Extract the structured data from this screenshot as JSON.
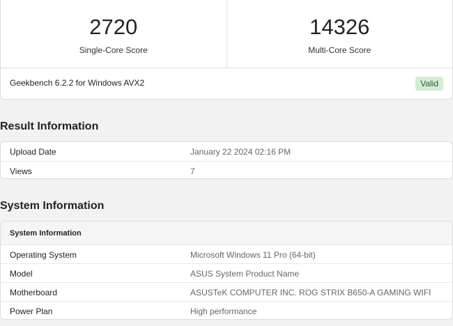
{
  "scores": {
    "single": {
      "value": "2720",
      "label": "Single-Core Score"
    },
    "multi": {
      "value": "14326",
      "label": "Multi-Core Score"
    }
  },
  "version": "Geekbench 6.2.2 for Windows AVX2",
  "validity": "Valid",
  "result_section": {
    "title": "Result Information",
    "rows": [
      {
        "key": "Upload Date",
        "value": "January 22 2024 02:16 PM"
      },
      {
        "key": "Views",
        "value": "7"
      }
    ]
  },
  "system_section": {
    "title": "System Information",
    "header": "System Information",
    "rows": [
      {
        "key": "Operating System",
        "value": "Microsoft Windows 11 Pro (64-bit)"
      },
      {
        "key": "Model",
        "value": "ASUS System Product Name"
      },
      {
        "key": "Motherboard",
        "value": "ASUSTeK COMPUTER INC. ROG STRIX B650-A GAMING WIFI"
      },
      {
        "key": "Power Plan",
        "value": "High performance"
      }
    ]
  },
  "colors": {
    "valid_bg": "#d4ecd6",
    "valid_text": "#2c5e33"
  }
}
